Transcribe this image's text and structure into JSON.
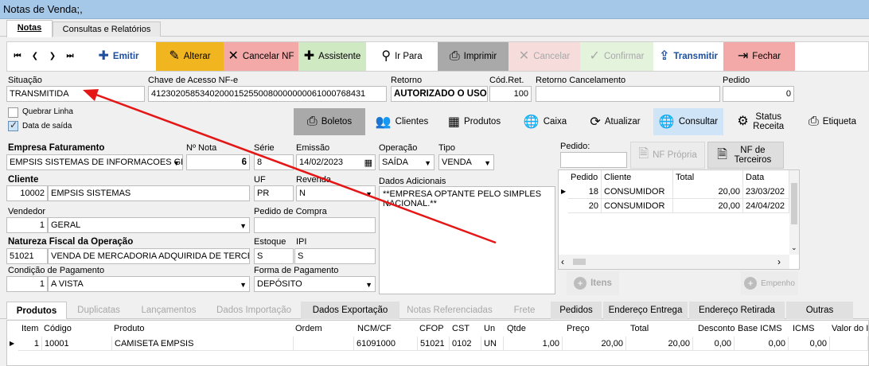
{
  "window": {
    "title": "Notas de Venda;,"
  },
  "tabs": [
    {
      "label": "Notas"
    },
    {
      "label": "Consultas e Relatórios"
    }
  ],
  "toolbar": {
    "emitir": "Emitir",
    "alterar": "Alterar",
    "cancelar_nf": "Cancelar NF",
    "assistente": "Assistente",
    "ir_para": "Ir Para",
    "imprimir": "Imprimir",
    "cancelar": "Cancelar",
    "confirmar": "Confirmar",
    "transmitir": "Transmitir",
    "fechar": "Fechar"
  },
  "header": {
    "situacao_label": "Situação",
    "situacao": "TRANSMITIDA",
    "chave_label": "Chave de Acesso NF-e",
    "chave": "41230205853402000152550080000000061000768431",
    "retorno_label": "Retorno",
    "retorno": "AUTORIZADO O USO",
    "cod_ret_label": "Cód.Ret.",
    "cod_ret": "100",
    "retorno_cancel_label": "Retorno Cancelamento",
    "retorno_cancel": "",
    "pedido_label": "Pedido",
    "pedido": "0"
  },
  "options": {
    "quebrar_linha": "Quebrar Linha",
    "data_saida": "Data de saída"
  },
  "secondary_toolbar": {
    "boletos": "Boletos",
    "clientes": "Clientes",
    "produtos": "Produtos",
    "caixa": "Caixa",
    "atualizar": "Atualizar",
    "consultar": "Consultar",
    "status_receita": "Status Receita",
    "etiqueta": "Etiqueta"
  },
  "form": {
    "empresa_label": "Empresa Faturamento",
    "empresa": "EMPSIS SISTEMAS DE INFORMACOES GEI",
    "nro_nota_label": "Nº Nota",
    "nro_nota": "6",
    "serie_label": "Série",
    "serie": "8",
    "emissao_label": "Emissão",
    "emissao": "14/02/2023",
    "operacao_label": "Operação",
    "operacao": "SAÍDA",
    "tipo_label": "Tipo",
    "tipo": "VENDA",
    "cliente_label": "Cliente",
    "cliente_cod": "10002",
    "cliente_nome": "EMPSIS SISTEMAS",
    "uf_label": "UF",
    "uf": "PR",
    "revenda_label": "Revenda",
    "revenda": "N",
    "dados_adic_label": "Dados Adicionais",
    "dados_adic": "**EMPRESA OPTANTE PELO SIMPLES NACIONAL.**",
    "vendedor_label": "Vendedor",
    "vendedor_cod": "1",
    "vendedor_nome": "GERAL",
    "pedido_compra_label": "Pedido de Compra",
    "pedido_compra": "",
    "natureza_label": "Natureza Fiscal da Operação",
    "natureza_cod": "51021",
    "natureza_desc": "VENDA DE MERCADORIA ADQUIRIDA DE TERCEIR",
    "estoque_label": "Estoque",
    "estoque": "S",
    "ipi_label": "IPI",
    "ipi": "S",
    "cond_pag_label": "Condição de Pagamento",
    "cond_pag_cod": "1",
    "cond_pag_desc": "A VISTA",
    "forma_pag_label": "Forma de Pagamento",
    "forma_pag": "DEPÓSITO"
  },
  "right_panel": {
    "pedido_label": "Pedido:",
    "pedido": "",
    "nf_propria": "NF Própria",
    "nf_terceiros": "NF de Terceiros",
    "columns": [
      "Pedido",
      "Cliente",
      "Total",
      "Data"
    ],
    "rows": [
      {
        "pedido": "18",
        "cliente": "CONSUMIDOR",
        "total": "20,00",
        "data": "23/03/202"
      },
      {
        "pedido": "20",
        "cliente": "CONSUMIDOR",
        "total": "20,00",
        "data": "24/04/202"
      }
    ],
    "itens_btn": "Itens",
    "empenho_btn": "Empenho"
  },
  "bottom_tabs": [
    {
      "label": "Produtos"
    },
    {
      "label": "Duplicatas"
    },
    {
      "label": "Lançamentos"
    },
    {
      "label": "Dados Importação"
    },
    {
      "label": "Dados Exportação"
    },
    {
      "label": "Notas Referenciadas"
    },
    {
      "label": "Frete"
    },
    {
      "label": "Pedidos"
    },
    {
      "label": "Endereço Entrega"
    },
    {
      "label": "Endereço Retirada"
    },
    {
      "label": "Outras"
    }
  ],
  "products": {
    "columns": [
      "Item",
      "Código",
      "Produto",
      "Ordem",
      "NCM/CF",
      "CFOP",
      "CST",
      "Un",
      "Qtde",
      "Preço",
      "Total",
      "Desconto",
      "Base ICMS",
      "ICMS",
      "Valor do I"
    ],
    "rows": [
      {
        "item": "1",
        "codigo": "10001",
        "produto": "CAMISETA EMPSIS",
        "ordem": "",
        "ncm": "61091000",
        "cfop": "51021",
        "cst": "0102",
        "un": "UN",
        "qtde": "1,00",
        "preco": "20,00",
        "total": "20,00",
        "desconto": "0,00",
        "base_icms": "0,00",
        "icms": "0,00"
      }
    ]
  },
  "colors": {
    "accent": "#1e4fa0",
    "alterar_bg": "#f0b51f",
    "cancelar_bg": "#f4a9a9",
    "assistente_bg": "#cfe9c3",
    "imprimir_bg": "#a9a9a9",
    "arrow": "#e41616"
  }
}
